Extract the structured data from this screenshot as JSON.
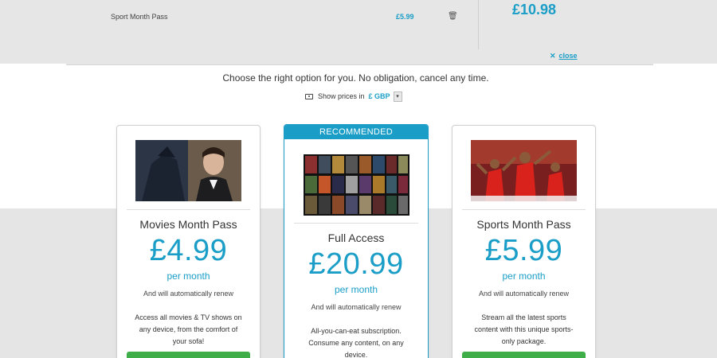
{
  "basket": {
    "item_name": "Sport Month Pass",
    "item_price": "£5.99",
    "trash_icon": "🗑",
    "total": "£10.98",
    "close_icon": "✕",
    "close_label": "close"
  },
  "intro": {
    "tagline": "Choose the right option for you. No obligation, cancel any time.",
    "currency_label": "Show prices in",
    "currency_value": "£ GBP",
    "currency_dropdown_icon": "chevron-down-icon"
  },
  "plans": [
    {
      "title": "Movies Month Pass",
      "price": "£4.99",
      "period": "per month",
      "renew": "And will automatically renew",
      "description": "Access all movies & TV shows on any device, from the comfort of your sofa!"
    },
    {
      "badge": "RECOMMENDED",
      "title": "Full Access",
      "price": "£20.99",
      "period": "per month",
      "renew": "And will automatically renew",
      "description": "All-you-can-eat subscription. Consume any content, on any device."
    },
    {
      "title": "Sports Month Pass",
      "price": "£5.99",
      "period": "per month",
      "renew": "And will automatically renew",
      "description": "Stream all the latest sports content with this unique sports-only package."
    }
  ],
  "colors": {
    "accent": "#1a9ec7",
    "button_green": "#3fae49",
    "panel_grey": "#e6e6e6"
  }
}
